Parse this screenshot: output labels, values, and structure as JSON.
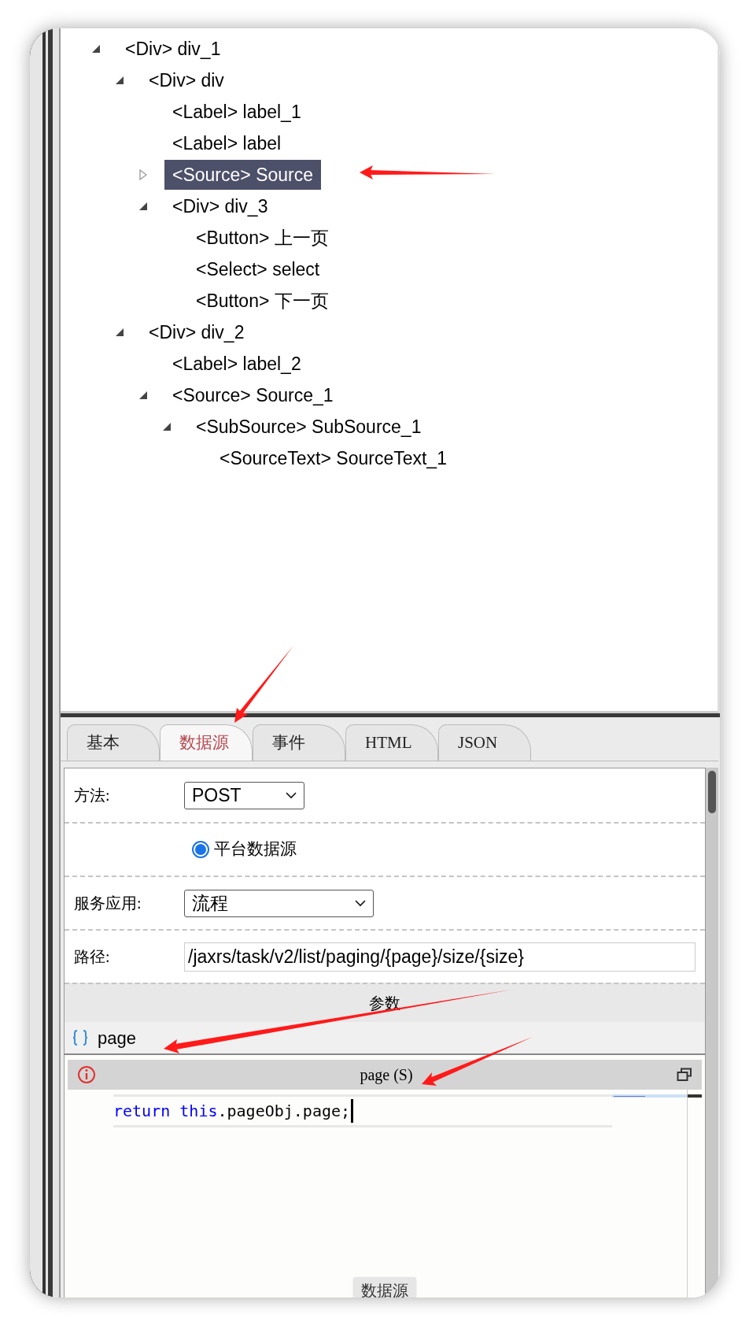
{
  "tree": [
    {
      "label": "<Div> div_1",
      "expanded": true,
      "selected": false,
      "children": [
        {
          "label": "<Div> div",
          "expanded": true,
          "selected": false,
          "children": [
            {
              "label": "<Label> label_1",
              "selected": false
            },
            {
              "label": "<Label> label",
              "selected": false
            },
            {
              "label": "<Source> Source",
              "expanded": false,
              "selected": true
            },
            {
              "label": "<Div> div_3",
              "expanded": true,
              "selected": false,
              "children": [
                {
                  "label": "<Button> 上一页",
                  "selected": false
                },
                {
                  "label": "<Select> select",
                  "selected": false
                },
                {
                  "label": "<Button> 下一页",
                  "selected": false
                }
              ]
            }
          ]
        },
        {
          "label": "<Div> div_2",
          "expanded": true,
          "selected": false,
          "children": [
            {
              "label": "<Label> label_2",
              "selected": false
            },
            {
              "label": "<Source> Source_1",
              "expanded": true,
              "selected": false,
              "children": [
                {
                  "label": "<SubSource> SubSource_1",
                  "expanded": true,
                  "selected": false,
                  "children": [
                    {
                      "label": "<SourceText> SourceText_1",
                      "selected": false
                    }
                  ]
                }
              ]
            }
          ]
        }
      ]
    }
  ],
  "property_tabs": [
    {
      "label": "基本",
      "selected": false
    },
    {
      "label": "数据源",
      "selected": true
    },
    {
      "label": "事件",
      "selected": false
    },
    {
      "label": "HTML",
      "selected": false
    },
    {
      "label": "JSON",
      "selected": false
    }
  ],
  "form": {
    "rows": [
      {
        "kind": "select",
        "label": "方法:",
        "value": "POST"
      },
      {
        "kind": "radio",
        "option": "平台数据源",
        "checked": true
      },
      {
        "kind": "select",
        "label": "服务应用:",
        "value": "流程"
      },
      {
        "kind": "text",
        "label": "路径:",
        "value": "/jaxrs/task/v2/list/paging/{page}/size/{size}"
      }
    ]
  },
  "params": {
    "title": "参数",
    "items": [
      {
        "name": "page"
      }
    ]
  },
  "editor": {
    "title": "page (S)",
    "code": [
      {
        "kind": "keyword",
        "text": "return "
      },
      {
        "kind": "keyword",
        "text": "this"
      },
      {
        "kind": "plain",
        "text": ".pageObj.page;"
      }
    ]
  },
  "tooltip": "数据源"
}
